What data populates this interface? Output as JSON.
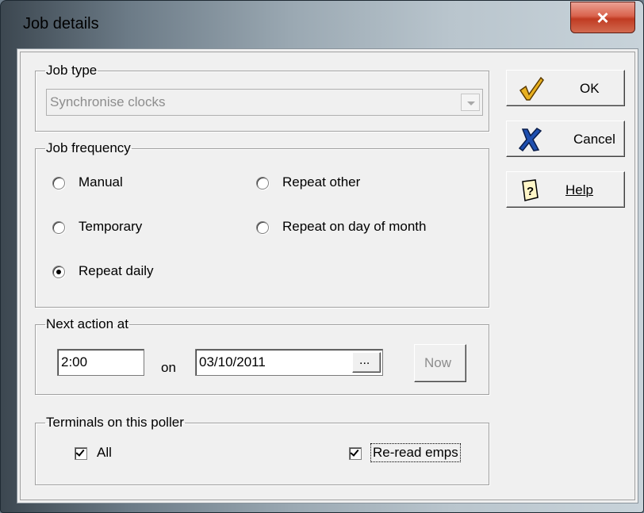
{
  "window": {
    "title": "Job details",
    "close_glyph": "×"
  },
  "job_type": {
    "legend": "Job type",
    "selected": "Synchronise clocks"
  },
  "job_frequency": {
    "legend": "Job frequency",
    "options": [
      {
        "label": "Manual",
        "checked": false
      },
      {
        "label": "Repeat other",
        "checked": false
      },
      {
        "label": "Temporary",
        "checked": false
      },
      {
        "label": "Repeat on day of month",
        "checked": false
      },
      {
        "label": "Repeat daily",
        "checked": true
      }
    ]
  },
  "next_action": {
    "legend": "Next action at",
    "time": "2:00",
    "on_label": "on",
    "date": "03/10/2011",
    "ellipsis": "...",
    "now_label": "Now"
  },
  "terminals": {
    "legend": "Terminals on this poller",
    "all_label": "All",
    "all_checked": true,
    "reread_label": "Re-read emps",
    "reread_checked": true
  },
  "buttons": {
    "ok": "OK",
    "cancel": "Cancel",
    "help": "Help"
  },
  "icons": {
    "ok": "checkmark-icon",
    "cancel": "x-cancel-icon",
    "help": "help-question-icon"
  }
}
